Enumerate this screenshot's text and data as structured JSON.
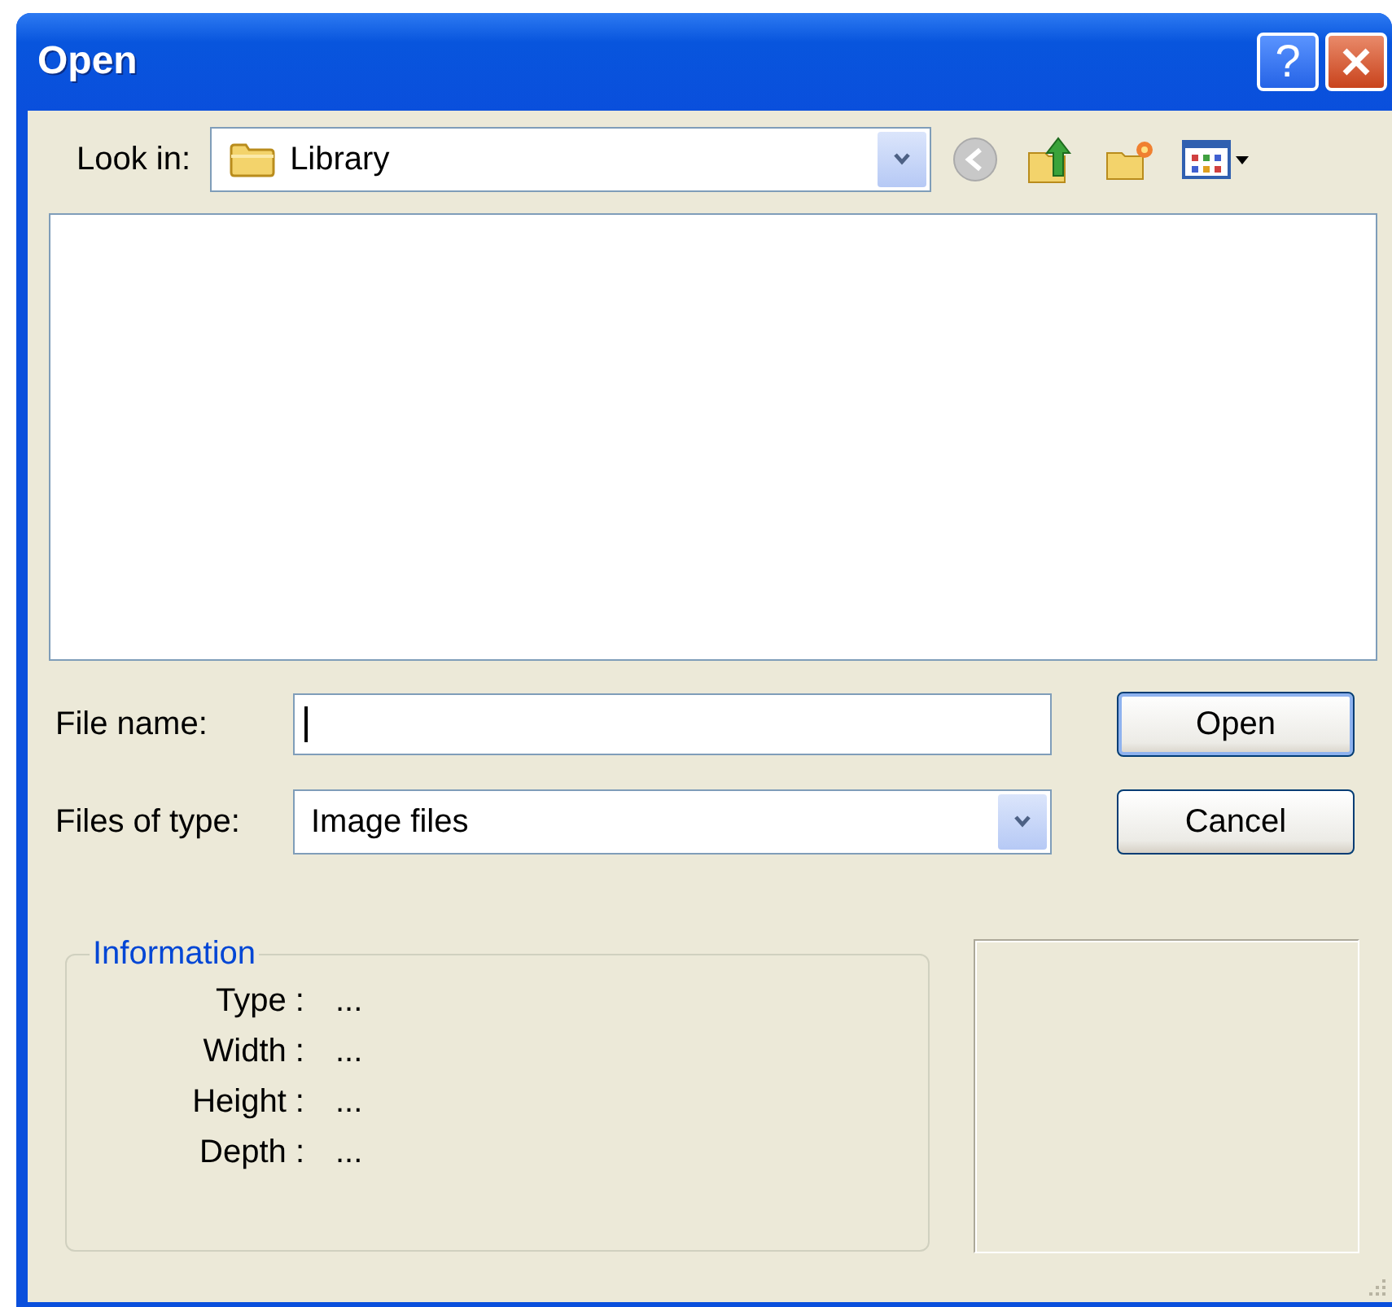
{
  "window": {
    "title": "Open",
    "help_label": "?"
  },
  "look_in": {
    "label": "Look in:",
    "value": "Library"
  },
  "file_name": {
    "label": "File name:"
  },
  "files_of_type": {
    "label": "Files of type:",
    "value": "Image files"
  },
  "buttons": [
    {
      "label": "Open",
      "default": true
    },
    {
      "label": "Cancel",
      "default": false
    }
  ],
  "information": {
    "title": "Information",
    "rows": [
      {
        "label": "Type :",
        "value": "..."
      },
      {
        "label": "Width :",
        "value": "..."
      },
      {
        "label": "Height :",
        "value": "..."
      },
      {
        "label": "Depth :",
        "value": "..."
      }
    ]
  }
}
